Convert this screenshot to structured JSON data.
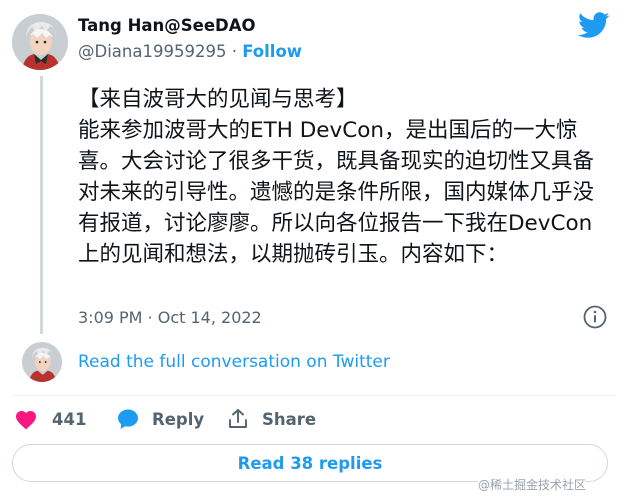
{
  "author": {
    "name": "Tang Han@SeeDAO",
    "handle": "@Diana19959295",
    "separator": "·",
    "follow_label": "Follow"
  },
  "tweet": {
    "text": "【来自波哥大的见闻与思考】\n能来参加波哥大的ETH DevCon，是出国后的一大惊喜。大会讨论了很多干货，既具备现实的迫切性又具备对未来的引导性。遗憾的是条件所限，国内媒体几乎没有报道，讨论廖廖。所以向各位报告一下我在DevCon上的见闻和想法，以期抛砖引玉。内容如下：",
    "timestamp": "3:09 PM · Oct 14, 2022"
  },
  "conversation_link": "Read the full conversation on Twitter",
  "actions": {
    "like_count": "441",
    "reply_label": "Reply",
    "share_label": "Share"
  },
  "replies_button": "Read 38 replies",
  "watermark": "@稀土掘金技术社区",
  "colors": {
    "accent": "#1d9bf0",
    "like": "#f91880",
    "muted": "#536471",
    "text": "#0f1419"
  },
  "icons": {
    "brand": "twitter-bird-icon",
    "info": "info-icon",
    "like": "heart-icon",
    "reply": "speech-bubble-icon",
    "share": "share-upload-icon"
  }
}
